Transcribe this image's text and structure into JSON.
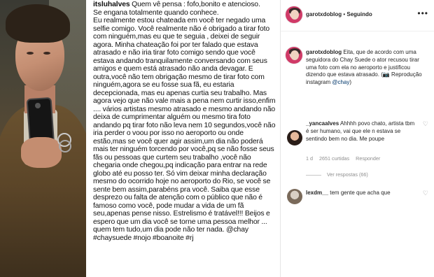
{
  "post": {
    "username": "itsluhalves",
    "text": " Quem vê pensa : fofo,bonito e atencioso.\nSe engana totalmente quando conhece.\nEu realmente estou chateada em você ter negado uma selfie comigo. Você realmente não é obrigado a tirar foto com ninguém,mas eu que te seguia , deixei de seguir agora. Minha chateação foi por ter falado que estava atrasado e não iria tirar foto comigo sendo que você estava andando tranquilamente conversando com seus amigos e quem está atrasado não anda devagar. E outra,você não tem obrigação mesmo de tirar foto com ninguém,agora se eu fosse sua fã, eu estaria decepcionada, mas eu apenas curtia seu trabalho. Mas agora vejo que não vale mais a pena nem curtir isso,enfim .... vários artistas mesmo atrasado e mesmo andando não deixa de cumprimentar alguém ou mesmo tira foto andando pq tirar foto não leva nem 10 segundos,você não iria perder o voou por isso no aeroporto ou onde estão,mas se você quer agir assim,um dia não poderá mais ter ninguém torcendo por você,pq se não fosse seus fãs ou pessoas que curtem seu trabalho ,você não chegaria onde chegou,pq indicação para entrar na rede globo até eu posso ter. Só vim deixar minha declaração mesmo do ocorrido hoje no aeroporto do Rio, se você se sente bem assim,parabéns pra você. Saiba que esse desprezo ou falta de atenção com o público que não é famoso como você, pode mudar a vida de um fã seu,apenas pense nisso. Estrelismo é tratável!!! Beijos e espero que um dia você se torne uma pessoa melhor ... quem tem tudo,um dia pode não ter nada. @chay #chaysuede #nojo #boanoite #rj"
  },
  "instagram": {
    "header_username": "garotxdoblog",
    "header_separator": " • ",
    "header_status": "Seguindo",
    "more_icon": "•••",
    "caption_username": "garotxdoblog",
    "caption_text": " Eita, que de acordo com uma seguidora do Chay Suede o ator recusou tirar uma foto com ela no aeroporto e justificou dizendo que estava atrasado. (📷 Reprodução instagram ",
    "caption_mention": "@chay",
    "caption_end": ")",
    "comment1": {
      "username": "_yancaalves",
      "text": " Ahhhh povo chato, artista tbm é ser humano, vai que ele n estava se sentindo bem no dia. Me poupe",
      "time": "1 d",
      "likes": "2651 curtidas",
      "reply": "Responder",
      "view_replies": "Ver respostas (66)"
    },
    "comment2": {
      "username": "lexdm__",
      "text": " tem gente que acha que"
    }
  }
}
